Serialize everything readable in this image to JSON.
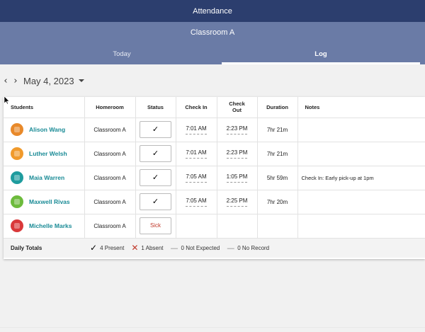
{
  "app": {
    "title": "Attendance"
  },
  "header": {
    "classroom": "Classroom A",
    "tabs": [
      {
        "label": "Today",
        "active": false
      },
      {
        "label": "Log",
        "active": true
      }
    ]
  },
  "datebar": {
    "prev_icon": "‹",
    "next_icon": "›",
    "date": "May 4, 2023"
  },
  "table": {
    "columns": [
      "Students",
      "Homeroom",
      "Status",
      "Check In",
      "Check Out",
      "Duration",
      "Notes"
    ],
    "rows": [
      {
        "name": "Alison Wang",
        "avatar_color": "#e8892a",
        "homeroom": "Classroom A",
        "status": "✓",
        "status_type": "present",
        "check_in": "7:01 AM",
        "check_out": "2:23 PM",
        "duration": "7hr 21m",
        "notes": ""
      },
      {
        "name": "Luther Welsh",
        "avatar_color": "#f09a2c",
        "homeroom": "Classroom A",
        "status": "✓",
        "status_type": "present",
        "check_in": "7:01 AM",
        "check_out": "2:23 PM",
        "duration": "7hr 21m",
        "notes": ""
      },
      {
        "name": "Maia Warren",
        "avatar_color": "#1f9c9e",
        "homeroom": "Classroom A",
        "status": "✓",
        "status_type": "present",
        "check_in": "7:05 AM",
        "check_out": "1:05 PM",
        "duration": "5hr 59m",
        "notes": "Check In: Early pick-up at 1pm"
      },
      {
        "name": "Maxwell Rivas",
        "avatar_color": "#6dbb3c",
        "homeroom": "Classroom A",
        "status": "✓",
        "status_type": "present",
        "check_in": "7:05 AM",
        "check_out": "2:25 PM",
        "duration": "7hr 20m",
        "notes": ""
      },
      {
        "name": "Michelle Marks",
        "avatar_color": "#d9383a",
        "homeroom": "Classroom A",
        "status": "Sick",
        "status_type": "sick",
        "check_in": "",
        "check_out": "",
        "duration": "",
        "notes": ""
      }
    ],
    "totals": {
      "label": "Daily Totals",
      "present": "4 Present",
      "absent": "1 Absent",
      "not_expected": "0 Not Expected",
      "no_record": "0 No Record"
    }
  }
}
